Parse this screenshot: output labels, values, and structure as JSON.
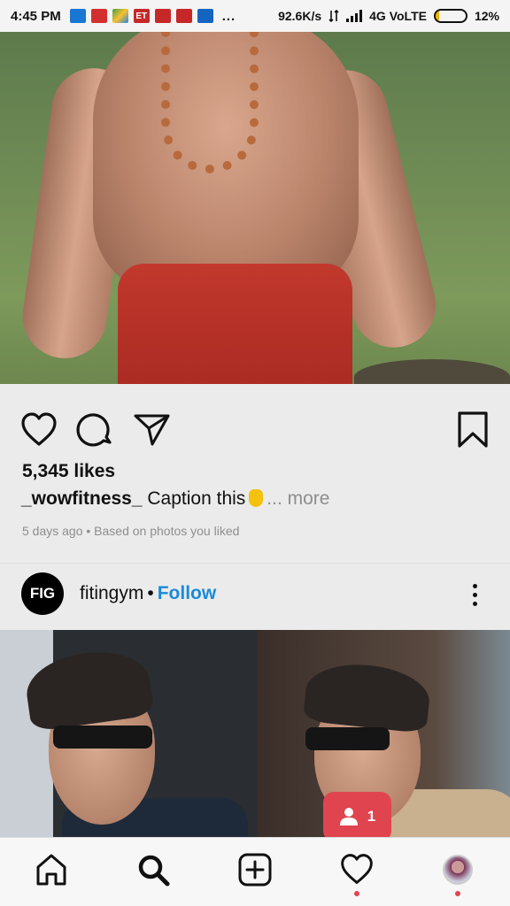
{
  "status_bar": {
    "time": "4:45 PM",
    "speed": "92.6K/s",
    "network": "4G VoLTE",
    "battery": "12%",
    "battery_level": 0.12,
    "more": "...",
    "app_icons": [
      "news-app-icon",
      "flipkart-app-icon",
      "photos-app-icon",
      "et-app-icon",
      "youtube-app-icon",
      "youtube-app-icon",
      "screen-app-icon"
    ],
    "app_colors": [
      "#1976d2",
      "#d32f2f",
      "#43a047",
      "#c62828",
      "#c62828",
      "#c62828",
      "#1565c0"
    ],
    "app_labels": [
      "",
      "",
      "",
      "ET",
      "",
      "",
      ""
    ]
  },
  "post1": {
    "likes": "5,345 likes",
    "username": "_wowfitness_",
    "caption": "Caption this",
    "more": "... more",
    "meta": "5 days ago • Based on photos you liked"
  },
  "post2": {
    "avatar_text": "FIG",
    "username": "fitingym",
    "dot": "•",
    "follow": "Follow"
  },
  "notification": {
    "count": "1"
  },
  "colors": {
    "accent_blue": "#1a8ad6",
    "notification_red": "#e0444f",
    "battery": "#f2b200"
  }
}
